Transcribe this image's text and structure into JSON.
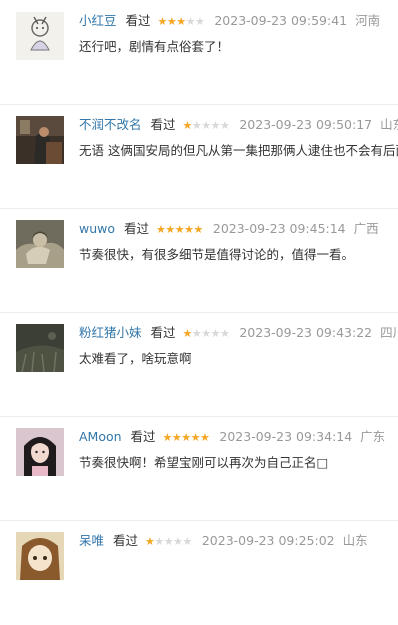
{
  "comments": [
    {
      "user": "小红豆",
      "status": "看过",
      "rating": 3,
      "time": "2023-09-23 09:59:41",
      "region": "河南",
      "text": "还行吧，剧情有点俗套了！",
      "avatar": "sketch-figure-avatar"
    },
    {
      "user": "不润不改名",
      "status": "看过",
      "rating": 1,
      "time": "2023-09-23 09:50:17",
      "region": "山东",
      "text": "无语 这俩国安局的但凡从第一集把那俩人逮住也不会有后面",
      "avatar": "dark-room-photo-avatar"
    },
    {
      "user": "wuwo",
      "status": "看过",
      "rating": 5,
      "time": "2023-09-23 09:45:14",
      "region": "广西",
      "text": "节奏很快，有很多细节是值得讨论的，值得一看。",
      "avatar": "anime-character-avatar"
    },
    {
      "user": "粉红猪小妹",
      "status": "看过",
      "rating": 1,
      "time": "2023-09-23 09:43:22",
      "region": "四川",
      "text": "太难看了，啥玩意啊",
      "avatar": "dark-grass-avatar"
    },
    {
      "user": "AMoon",
      "status": "看过",
      "rating": 5,
      "time": "2023-09-23 09:34:14",
      "region": "广东",
      "text": "节奏很快啊！希望宝刚可以再次为自己正名□",
      "avatar": "girl-portrait-avatar"
    },
    {
      "user": "呆唯",
      "status": "看过",
      "rating": 1,
      "time": "2023-09-23 09:25:02",
      "region": "山东",
      "text": "",
      "avatar": "anime-girl-avatar"
    }
  ],
  "colors": {
    "link": "#3377aa",
    "star": "#f5a623",
    "star_off": "#d8d8d8",
    "muted": "#999999",
    "text": "#333333"
  }
}
